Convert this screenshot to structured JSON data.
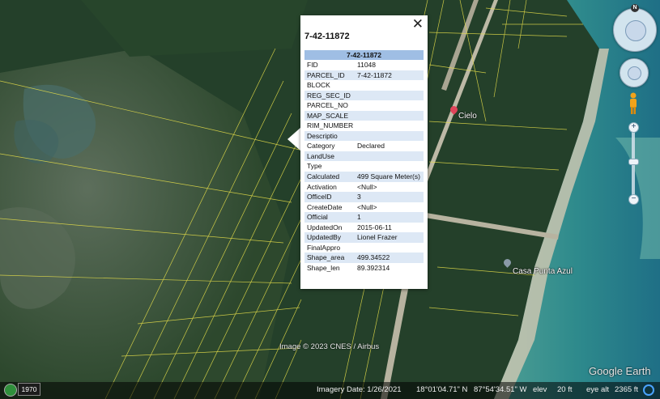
{
  "popup": {
    "title": "7-42-11872",
    "close_label": "✕",
    "table_header": "7-42-11872",
    "rows": [
      {
        "key": "FID",
        "value": "11048"
      },
      {
        "key": "PARCEL_ID",
        "value": "7-42-11872"
      },
      {
        "key": "BLOCK",
        "value": ""
      },
      {
        "key": "REG_SEC_ID",
        "value": ""
      },
      {
        "key": "PARCEL_NO",
        "value": ""
      },
      {
        "key": "MAP_SCALE",
        "value": ""
      },
      {
        "key": "RIM_NUMBER",
        "value": ""
      },
      {
        "key": "Descriptio",
        "value": ""
      },
      {
        "key": "Category",
        "value": "Declared"
      },
      {
        "key": "LandUse",
        "value": ""
      },
      {
        "key": "Type",
        "value": ""
      },
      {
        "key": "Calculated",
        "value": "499 Square Meter(s)"
      },
      {
        "key": "Activation",
        "value": "<Null>"
      },
      {
        "key": "OfficeID",
        "value": "3"
      },
      {
        "key": "CreateDate",
        "value": "<Null>"
      },
      {
        "key": "Official",
        "value": "1"
      },
      {
        "key": "UpdatedOn",
        "value": "2015-06-11"
      },
      {
        "key": "UpdatedBy",
        "value": "Lionel Frazer"
      },
      {
        "key": "FinalAppro",
        "value": ""
      },
      {
        "key": "Shape_area",
        "value": "499.34522"
      },
      {
        "key": "Shape_len",
        "value": "89.392314"
      }
    ]
  },
  "places": {
    "cielo": "Cielo",
    "casa": "Casa Punta Azul"
  },
  "attribution": "Image © 2023 CNES / Airbus",
  "logo": "Google Earth",
  "statusbar": {
    "year": "1970",
    "imagery_date": "Imagery Date: 1/26/2021",
    "lat": "18°01'04.71\" N",
    "lon": "87°54'34.51\" W",
    "elev_label": "elev",
    "elev_value": "20 ft",
    "eye_label": "eye alt",
    "eye_value": "2365 ft"
  },
  "nav": {
    "north_label": "N",
    "zoom_in": "+",
    "zoom_out": "−"
  },
  "colors": {
    "parcel_lines": "#e8e04a",
    "table_header": "#9fbee4",
    "table_alt_row": "#dde8f5",
    "pin_red": "#e0445a",
    "pin_gray": "#8a9aa8"
  }
}
